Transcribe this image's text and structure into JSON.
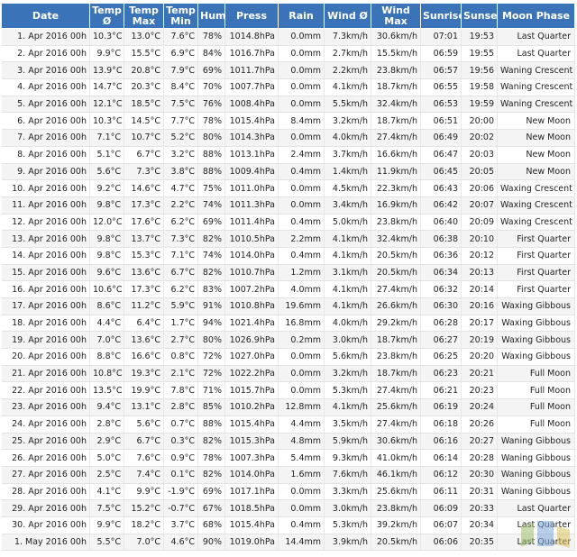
{
  "headers": {
    "date": "Date",
    "temp": "Temp Ø",
    "temp_max": "Temp Max",
    "temp_min": "Temp Min",
    "hum": "Hum",
    "press": "Press",
    "rain": "Rain",
    "wind": "Wind Ø",
    "wind_max": "Wind Max",
    "sunrise": "Sunrise",
    "sunset": "Sunset",
    "moon": "Moon Phase"
  },
  "rows": [
    [
      "1. Apr 2016 00h",
      "10.3°C",
      "13.0°C",
      "7.6°C",
      "78%",
      "1014.8hPa",
      "0.0mm",
      "7.3km/h",
      "30.6km/h",
      "07:01",
      "19:53",
      "Last Quarter"
    ],
    [
      "2. Apr 2016 00h",
      "9.9°C",
      "15.5°C",
      "6.9°C",
      "84%",
      "1016.7hPa",
      "0.0mm",
      "2.7km/h",
      "15.5km/h",
      "06:59",
      "19:55",
      "Last Quarter"
    ],
    [
      "3. Apr 2016 00h",
      "13.9°C",
      "20.8°C",
      "7.9°C",
      "69%",
      "1011.7hPa",
      "0.0mm",
      "2.2km/h",
      "23.8km/h",
      "06:57",
      "19:56",
      "Waning Crescent"
    ],
    [
      "4. Apr 2016 00h",
      "14.7°C",
      "20.3°C",
      "8.4°C",
      "70%",
      "1007.7hPa",
      "0.0mm",
      "4.1km/h",
      "18.7km/h",
      "06:55",
      "19:58",
      "Waning Crescent"
    ],
    [
      "5. Apr 2016 00h",
      "12.1°C",
      "18.5°C",
      "7.5°C",
      "76%",
      "1008.4hPa",
      "0.0mm",
      "5.5km/h",
      "32.4km/h",
      "06:53",
      "19:59",
      "Waning Crescent"
    ],
    [
      "6. Apr 2016 00h",
      "10.3°C",
      "14.5°C",
      "7.7°C",
      "78%",
      "1015.4hPa",
      "8.4mm",
      "3.2km/h",
      "18.7km/h",
      "06:51",
      "20:00",
      "New Moon"
    ],
    [
      "7. Apr 2016 00h",
      "7.1°C",
      "10.7°C",
      "5.2°C",
      "80%",
      "1014.3hPa",
      "0.0mm",
      "4.0km/h",
      "27.4km/h",
      "06:49",
      "20:02",
      "New Moon"
    ],
    [
      "8. Apr 2016 00h",
      "5.1°C",
      "6.7°C",
      "3.2°C",
      "88%",
      "1013.1hPa",
      "2.4mm",
      "3.7km/h",
      "16.6km/h",
      "06:47",
      "20:03",
      "New Moon"
    ],
    [
      "9. Apr 2016 00h",
      "5.6°C",
      "7.3°C",
      "3.8°C",
      "88%",
      "1009.4hPa",
      "0.4mm",
      "1.4km/h",
      "11.9km/h",
      "06:45",
      "20:05",
      "New Moon"
    ],
    [
      "10. Apr 2016 00h",
      "9.2°C",
      "14.6°C",
      "4.7°C",
      "75%",
      "1011.0hPa",
      "0.0mm",
      "4.5km/h",
      "22.3km/h",
      "06:43",
      "20:06",
      "Waxing Crescent"
    ],
    [
      "11. Apr 2016 00h",
      "9.8°C",
      "17.3°C",
      "2.2°C",
      "74%",
      "1011.3hPa",
      "0.0mm",
      "3.4km/h",
      "16.9km/h",
      "06:42",
      "20:07",
      "Waxing Crescent"
    ],
    [
      "12. Apr 2016 00h",
      "12.0°C",
      "17.6°C",
      "6.2°C",
      "69%",
      "1011.4hPa",
      "0.4mm",
      "5.0km/h",
      "23.8km/h",
      "06:40",
      "20:09",
      "Waxing Crescent"
    ],
    [
      "13. Apr 2016 00h",
      "9.8°C",
      "13.7°C",
      "7.3°C",
      "82%",
      "1010.5hPa",
      "2.2mm",
      "4.1km/h",
      "32.4km/h",
      "06:38",
      "20:10",
      "First Quarter"
    ],
    [
      "14. Apr 2016 00h",
      "9.8°C",
      "15.3°C",
      "7.1°C",
      "74%",
      "1014.0hPa",
      "0.4mm",
      "4.1km/h",
      "20.5km/h",
      "06:36",
      "20:12",
      "First Quarter"
    ],
    [
      "15. Apr 2016 00h",
      "9.6°C",
      "13.6°C",
      "6.7°C",
      "82%",
      "1010.7hPa",
      "1.2mm",
      "3.1km/h",
      "20.5km/h",
      "06:34",
      "20:13",
      "First Quarter"
    ],
    [
      "16. Apr 2016 00h",
      "10.6°C",
      "17.3°C",
      "6.2°C",
      "83%",
      "1007.2hPa",
      "4.0mm",
      "4.1km/h",
      "27.4km/h",
      "06:32",
      "20:14",
      "First Quarter"
    ],
    [
      "17. Apr 2016 00h",
      "8.6°C",
      "11.2°C",
      "5.9°C",
      "91%",
      "1010.8hPa",
      "19.6mm",
      "4.1km/h",
      "26.6km/h",
      "06:30",
      "20:16",
      "Waxing Gibbous"
    ],
    [
      "18. Apr 2016 00h",
      "4.4°C",
      "6.4°C",
      "1.7°C",
      "94%",
      "1021.4hPa",
      "16.8mm",
      "4.0km/h",
      "29.2km/h",
      "06:28",
      "20:17",
      "Waxing Gibbous"
    ],
    [
      "19. Apr 2016 00h",
      "7.0°C",
      "13.6°C",
      "2.7°C",
      "80%",
      "1026.9hPa",
      "0.2mm",
      "3.0km/h",
      "18.7km/h",
      "06:27",
      "20:19",
      "Waxing Gibbous"
    ],
    [
      "20. Apr 2016 00h",
      "8.8°C",
      "16.6°C",
      "0.8°C",
      "72%",
      "1027.0hPa",
      "0.0mm",
      "5.6km/h",
      "23.8km/h",
      "06:25",
      "20:20",
      "Waxing Gibbous"
    ],
    [
      "21. Apr 2016 00h",
      "10.8°C",
      "19.3°C",
      "2.1°C",
      "72%",
      "1022.2hPa",
      "0.0mm",
      "3.2km/h",
      "18.7km/h",
      "06:23",
      "20:21",
      "Full Moon"
    ],
    [
      "22. Apr 2016 00h",
      "13.5°C",
      "19.9°C",
      "7.8°C",
      "71%",
      "1015.7hPa",
      "0.0mm",
      "5.3km/h",
      "27.4km/h",
      "06:21",
      "20:23",
      "Full Moon"
    ],
    [
      "23. Apr 2016 00h",
      "9.4°C",
      "13.1°C",
      "2.8°C",
      "85%",
      "1010.2hPa",
      "12.8mm",
      "4.1km/h",
      "25.6km/h",
      "06:19",
      "20:24",
      "Full Moon"
    ],
    [
      "24. Apr 2016 00h",
      "2.8°C",
      "5.6°C",
      "0.7°C",
      "88%",
      "1015.4hPa",
      "4.4mm",
      "3.5km/h",
      "27.4km/h",
      "06:18",
      "20:26",
      "Full Moon"
    ],
    [
      "25. Apr 2016 00h",
      "2.9°C",
      "6.7°C",
      "0.3°C",
      "82%",
      "1015.3hPa",
      "4.8mm",
      "5.9km/h",
      "30.6km/h",
      "06:16",
      "20:27",
      "Waning Gibbous"
    ],
    [
      "26. Apr 2016 00h",
      "5.0°C",
      "7.6°C",
      "0.9°C",
      "78%",
      "1007.3hPa",
      "5.4mm",
      "9.3km/h",
      "41.0km/h",
      "06:14",
      "20:28",
      "Waning Gibbous"
    ],
    [
      "27. Apr 2016 00h",
      "2.5°C",
      "7.4°C",
      "0.1°C",
      "82%",
      "1014.0hPa",
      "1.6mm",
      "7.6km/h",
      "46.1km/h",
      "06:12",
      "20:30",
      "Waning Gibbous"
    ],
    [
      "28. Apr 2016 00h",
      "4.1°C",
      "9.9°C",
      "-1.9°C",
      "69%",
      "1017.1hPa",
      "0.0mm",
      "3.3km/h",
      "25.6km/h",
      "06:11",
      "20:31",
      "Waning Gibbous"
    ],
    [
      "29. Apr 2016 00h",
      "7.5°C",
      "15.2°C",
      "-0.7°C",
      "67%",
      "1018.5hPa",
      "0.0mm",
      "3.0km/h",
      "23.8km/h",
      "06:09",
      "20:33",
      "Last Quarter"
    ],
    [
      "30. Apr 2016 00h",
      "9.9°C",
      "18.2°C",
      "3.7°C",
      "68%",
      "1015.4hPa",
      "0.4mm",
      "5.3km/h",
      "39.2km/h",
      "06:07",
      "20:34",
      "Last Quarter"
    ],
    [
      "1. May 2016 00h",
      "5.5°C",
      "7.0°C",
      "4.6°C",
      "90%",
      "1019.0hPa",
      "14.4mm",
      "3.9km/h",
      "20.5km/h",
      "06:06",
      "20:35",
      "Last Quarter"
    ]
  ],
  "colors": {
    "header_bg": "#3a73b7",
    "header_text": "#ffffff",
    "row_odd": "#f4f4f4",
    "row_even": "#ffffff"
  }
}
